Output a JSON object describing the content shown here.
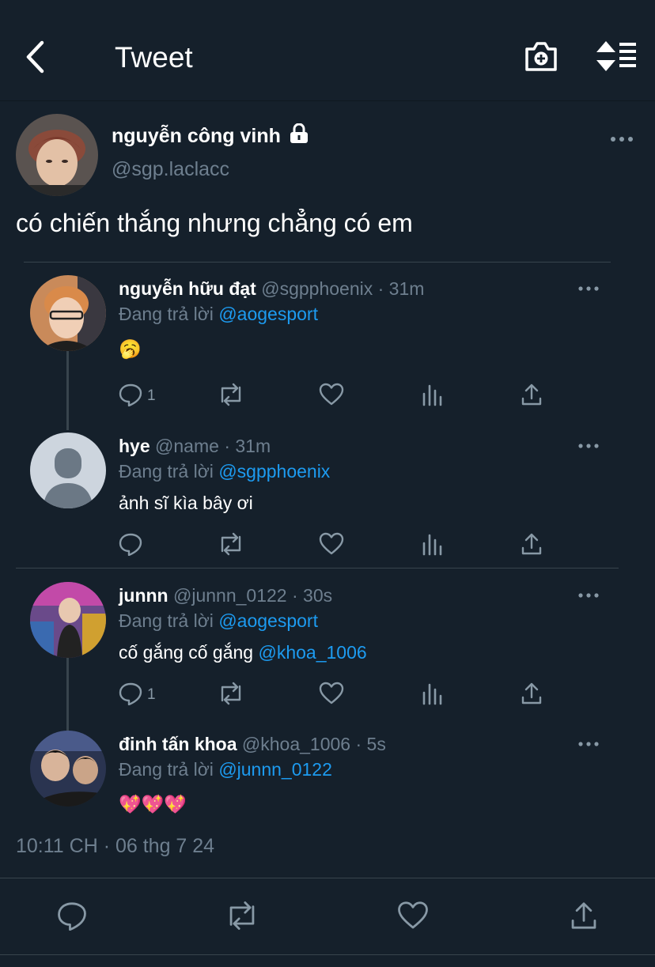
{
  "header": {
    "title": "Tweet"
  },
  "main_tweet": {
    "name": "nguyễn công vinh",
    "handle": "@sgp.laclacc",
    "text": "có chiến thắng nhưng chẳng có em"
  },
  "replies": [
    {
      "name": "nguyễn hữu đạt",
      "handle": "@sgpphoenix",
      "time": "31m",
      "replying_label": "Đang trả lời",
      "replying_to": "@aogesport",
      "text": "🥱",
      "reply_count": "1"
    },
    {
      "name": "hye",
      "handle": "@name",
      "time": "31m",
      "replying_label": "Đang trả lời",
      "replying_to": "@sgpphoenix",
      "text": "ảnh sĩ kìa bây ơi",
      "reply_count": ""
    },
    {
      "name": "junnn",
      "handle": "@junnn_0122",
      "time": "30s",
      "replying_label": "Đang trả lời",
      "replying_to": "@aogesport",
      "text": "cố gắng cố gắng ",
      "mention": "@khoa_1006",
      "reply_count": "1"
    },
    {
      "name": "đinh tấn khoa",
      "handle": "@khoa_1006",
      "time": "5s",
      "replying_label": "Đang trả lời",
      "replying_to": "@junnn_0122",
      "text": "💖💖💖",
      "reply_count": ""
    }
  ],
  "timestamp": "10:11 CH · 06 thg 7 24",
  "colors": {
    "background": "#15202b",
    "accent": "#1d9bf0",
    "muted": "#6e7f8f",
    "divider": "#38444d"
  }
}
